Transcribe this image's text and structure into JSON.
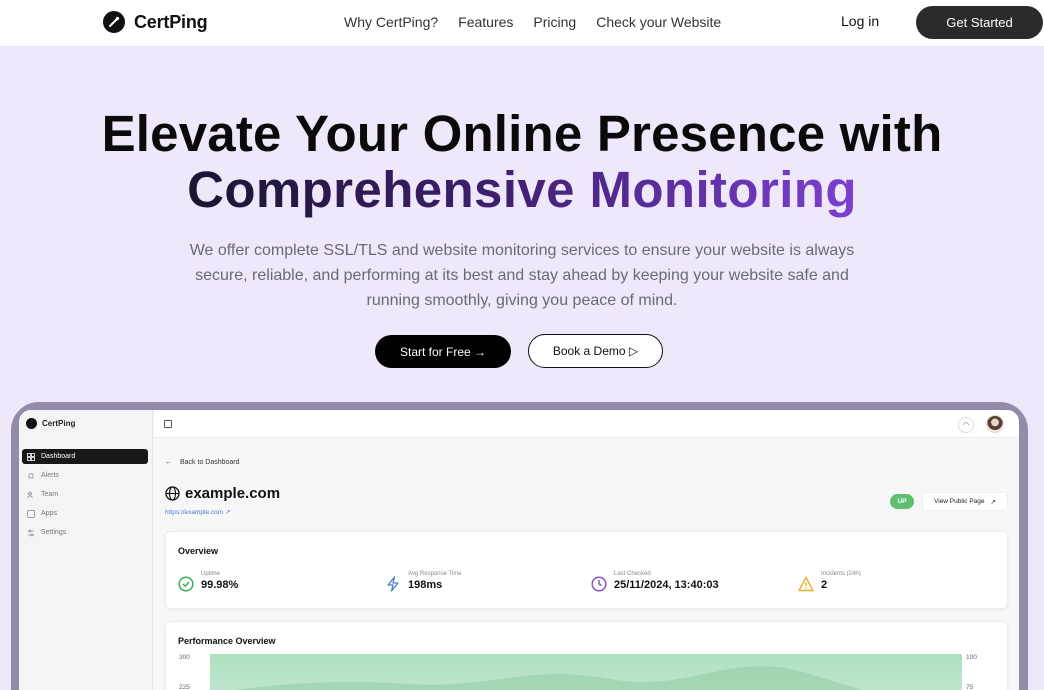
{
  "nav": {
    "brand": "CertPing",
    "links": [
      "Why CertPing?",
      "Features",
      "Pricing",
      "Check your Website"
    ],
    "login": "Log in",
    "cta": "Get Started"
  },
  "hero": {
    "line1": "Elevate Your Online Presence with",
    "line2": "Comprehensive Monitoring",
    "subtitle": "We offer complete SSL/TLS and website monitoring services to ensure your website is always secure, reliable, and performing at its best and stay ahead by keeping your website safe and running smoothly, giving you peace of mind.",
    "primary_button": "Start for Free →",
    "secondary_button": "Book a Demo ▷"
  },
  "dashboard": {
    "brand": "CertPing",
    "sidebar": [
      "Dashboard",
      "Alerts",
      "Team",
      "Apps",
      "Settings"
    ],
    "back": "Back to Dashboard",
    "site": "example.com",
    "url": "https://example.com",
    "status": "UP",
    "view_public": "View Public Page",
    "overview": {
      "title": "Overview",
      "stats": [
        {
          "label": "Uptime",
          "value": "99.98%",
          "color": "#3fae5a",
          "icon": "check-circle-icon"
        },
        {
          "label": "Avg Response Time",
          "value": "198ms",
          "color": "#4a7cd0",
          "icon": "lightning-icon"
        },
        {
          "label": "Last Checked",
          "value": "25/11/2024, 13:40:03",
          "color": "#8b55c9",
          "icon": "clock-icon"
        },
        {
          "label": "Incidents (24h)",
          "value": "2",
          "color": "#e2b32a",
          "icon": "warning-icon"
        }
      ]
    },
    "performance": {
      "title": "Performance Overview",
      "left_ticks": [
        "300",
        "225"
      ],
      "right_ticks": [
        "100",
        "75"
      ]
    }
  },
  "colors": {
    "background": "#efe8fb",
    "accent": "#7c3fd3",
    "device_frame": "#958aa9"
  }
}
